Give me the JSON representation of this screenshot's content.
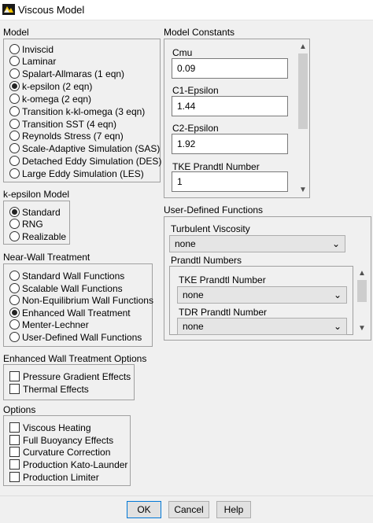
{
  "window": {
    "title": "Viscous Model"
  },
  "model": {
    "label": "Model",
    "options": [
      {
        "label": "Inviscid",
        "selected": false
      },
      {
        "label": "Laminar",
        "selected": false
      },
      {
        "label": "Spalart-Allmaras (1 eqn)",
        "selected": false
      },
      {
        "label": "k-epsilon (2 eqn)",
        "selected": true
      },
      {
        "label": "k-omega (2 eqn)",
        "selected": false
      },
      {
        "label": "Transition k-kl-omega (3 eqn)",
        "selected": false
      },
      {
        "label": "Transition SST (4 eqn)",
        "selected": false
      },
      {
        "label": "Reynolds Stress (7 eqn)",
        "selected": false
      },
      {
        "label": "Scale-Adaptive Simulation (SAS)",
        "selected": false
      },
      {
        "label": "Detached Eddy Simulation (DES)",
        "selected": false
      },
      {
        "label": "Large Eddy Simulation (LES)",
        "selected": false
      }
    ]
  },
  "ke_model": {
    "label": "k-epsilon Model",
    "options": [
      {
        "label": "Standard",
        "selected": true
      },
      {
        "label": "RNG",
        "selected": false
      },
      {
        "label": "Realizable",
        "selected": false
      }
    ]
  },
  "near_wall": {
    "label": "Near-Wall Treatment",
    "options": [
      {
        "label": "Standard Wall Functions",
        "selected": false
      },
      {
        "label": "Scalable Wall Functions",
        "selected": false
      },
      {
        "label": "Non-Equilibrium Wall Functions",
        "selected": false
      },
      {
        "label": "Enhanced Wall Treatment",
        "selected": true
      },
      {
        "label": "Menter-Lechner",
        "selected": false
      },
      {
        "label": "User-Defined Wall Functions",
        "selected": false
      }
    ]
  },
  "enhanced_wall": {
    "label": "Enhanced Wall Treatment Options",
    "options": [
      {
        "label": "Pressure Gradient Effects",
        "checked": false
      },
      {
        "label": "Thermal Effects",
        "checked": false
      }
    ]
  },
  "options": {
    "label": "Options",
    "items": [
      {
        "label": "Viscous Heating",
        "checked": false
      },
      {
        "label": "Full Buoyancy Effects",
        "checked": false
      },
      {
        "label": "Curvature Correction",
        "checked": false
      },
      {
        "label": "Production Kato-Launder",
        "checked": false
      },
      {
        "label": "Production Limiter",
        "checked": false
      }
    ]
  },
  "constants": {
    "label": "Model Constants",
    "fields": [
      {
        "label": "Cmu",
        "value": "0.09"
      },
      {
        "label": "C1-Epsilon",
        "value": "1.44"
      },
      {
        "label": "C2-Epsilon",
        "value": "1.92"
      },
      {
        "label": "TKE Prandtl Number",
        "value": "1"
      }
    ]
  },
  "udf": {
    "label": "User-Defined Functions",
    "turbulent_viscosity": {
      "label": "Turbulent Viscosity",
      "value": "none"
    },
    "prandtl_label": "Prandtl Numbers",
    "prandtl": [
      {
        "label": "TKE Prandtl Number",
        "value": "none"
      },
      {
        "label": "TDR Prandtl Number",
        "value": "none"
      }
    ]
  },
  "buttons": {
    "ok": "OK",
    "cancel": "Cancel",
    "help": "Help"
  },
  "icons": {
    "app": "fluent-app-icon",
    "dropdown": "chevron-down-icon",
    "scroll_up": "scroll-up-icon",
    "scroll_down": "scroll-down-icon"
  }
}
